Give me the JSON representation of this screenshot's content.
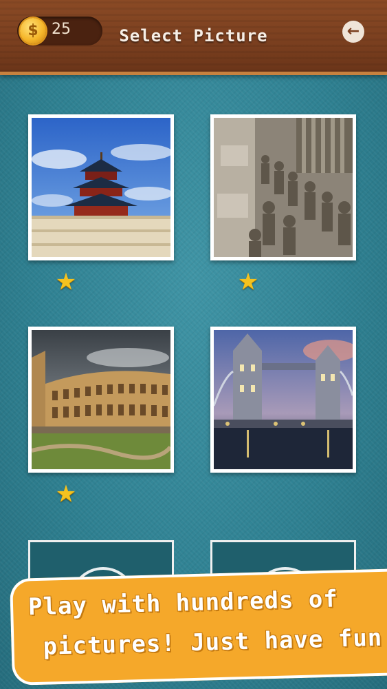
{
  "header": {
    "coin_icon": "coin-icon",
    "coin_symbol": "$",
    "coin_count": "25",
    "title": "Select Picture",
    "back_icon": "back-arrow-icon",
    "back_glyph": "←"
  },
  "colors": {
    "background": "#2f7f90",
    "header_wood": "#7a3f1f",
    "star": "#f4c21f",
    "promo": "#f5a82a"
  },
  "pictures": [
    {
      "subject": "temple-of-heaven",
      "stars": 1
    },
    {
      "subject": "terracotta-army",
      "stars": 1
    },
    {
      "subject": "colosseum",
      "stars": 1
    },
    {
      "subject": "tower-bridge",
      "stars": 0
    },
    {
      "subject": "locked",
      "stars": 0
    },
    {
      "subject": "locked",
      "stars": 0
    }
  ],
  "star_glyph": "★",
  "promo": {
    "line1": "Play with hundreds of",
    "line2": "pictures! Just have fun"
  }
}
